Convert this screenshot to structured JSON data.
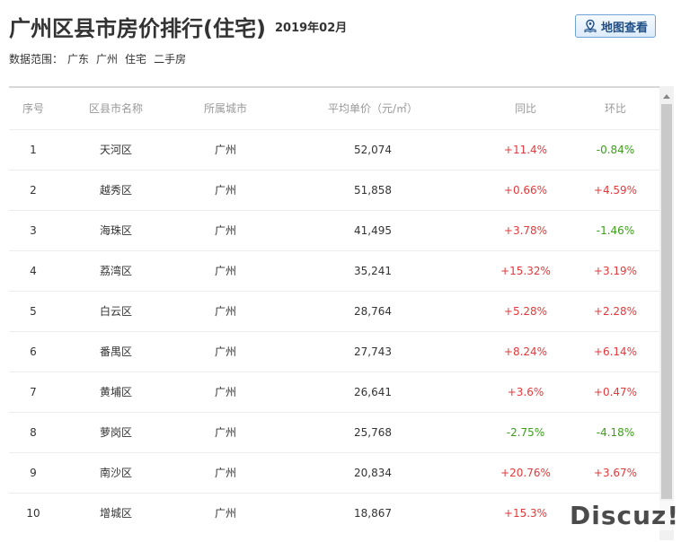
{
  "header": {
    "title": "广州区县市房价排行(住宅)",
    "date": "2019年02月",
    "map_button": "地图查看"
  },
  "scope": {
    "label": "数据范围：",
    "tags": [
      "广东",
      "广州",
      "住宅",
      "二手房"
    ]
  },
  "table": {
    "columns": [
      "序号",
      "区县市名称",
      "所属城市",
      "平均单价（元/㎡）",
      "同比",
      "环比"
    ],
    "rows": [
      {
        "rank": "1",
        "district": "天河区",
        "city": "广州",
        "price": "52,074",
        "yoy": "+11.4%",
        "mom": "-0.84%"
      },
      {
        "rank": "2",
        "district": "越秀区",
        "city": "广州",
        "price": "51,858",
        "yoy": "+0.66%",
        "mom": "+4.59%"
      },
      {
        "rank": "3",
        "district": "海珠区",
        "city": "广州",
        "price": "41,495",
        "yoy": "+3.78%",
        "mom": "-1.46%"
      },
      {
        "rank": "4",
        "district": "荔湾区",
        "city": "广州",
        "price": "35,241",
        "yoy": "+15.32%",
        "mom": "+3.19%"
      },
      {
        "rank": "5",
        "district": "白云区",
        "city": "广州",
        "price": "28,764",
        "yoy": "+5.28%",
        "mom": "+2.28%"
      },
      {
        "rank": "6",
        "district": "番禺区",
        "city": "广州",
        "price": "27,743",
        "yoy": "+8.24%",
        "mom": "+6.14%"
      },
      {
        "rank": "7",
        "district": "黄埔区",
        "city": "广州",
        "price": "26,641",
        "yoy": "+3.6%",
        "mom": "+0.47%"
      },
      {
        "rank": "8",
        "district": "萝岗区",
        "city": "广州",
        "price": "25,768",
        "yoy": "-2.75%",
        "mom": "-4.18%"
      },
      {
        "rank": "9",
        "district": "南沙区",
        "city": "广州",
        "price": "20,834",
        "yoy": "+20.76%",
        "mom": "+3.67%"
      },
      {
        "rank": "10",
        "district": "增城区",
        "city": "广州",
        "price": "18,867",
        "yoy": "+15.3%",
        "mom": ""
      }
    ]
  },
  "watermark": "Discuz!",
  "colors": {
    "up": "#e4393c",
    "down": "#3d9d1c",
    "button_border": "#6fa3d8",
    "button_text": "#1f4f86"
  },
  "icons": {
    "map_button": "map-pin-icon",
    "scroll": "scroll-up-arrow-icon"
  }
}
